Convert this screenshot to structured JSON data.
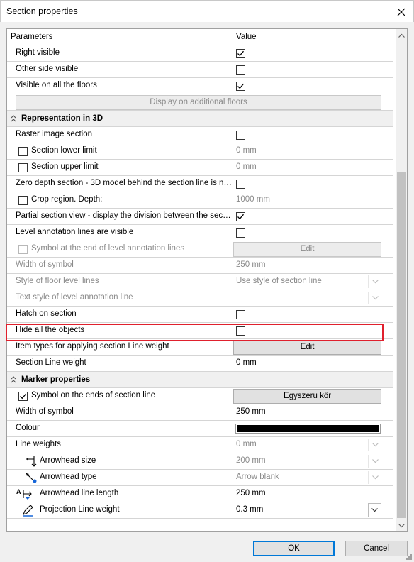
{
  "window": {
    "title": "Section properties"
  },
  "grid": {
    "header": {
      "parameters": "Parameters",
      "value": "Value"
    },
    "rows": {
      "right_visible": {
        "label": "Right visible",
        "checked": true
      },
      "other_side_visible": {
        "label": "Other side visible",
        "checked": false
      },
      "visible_all_floors": {
        "label": "Visible on all the floors",
        "checked": true
      },
      "display_additional": {
        "label": "Display on additional floors"
      },
      "rep3d": {
        "label": "Representation in 3D"
      },
      "raster_section": {
        "label": "Raster image section",
        "checked": false
      },
      "section_lower": {
        "label": "Section lower limit",
        "value": "0 mm",
        "checked": false
      },
      "section_upper": {
        "label": "Section upper limit",
        "value": "0 mm",
        "checked": false
      },
      "zero_depth": {
        "label": "Zero depth section - 3D model behind the section line is n…",
        "checked": false
      },
      "crop_region": {
        "label": "Crop region. Depth:",
        "value": "1000 mm",
        "checked": false
      },
      "partial_section": {
        "label": "Partial section view - display the division between the sec…",
        "checked": true
      },
      "level_annotation": {
        "label": "Level annotation lines are visible",
        "checked": false
      },
      "symbol_end_level": {
        "label": "Symbol at the end of level annotation lines",
        "button": "Edit",
        "checked": false
      },
      "width_symbol_1": {
        "label": "Width of symbol",
        "value": "250 mm"
      },
      "style_floor": {
        "label": "Style of floor level lines",
        "value": "Use style of section line"
      },
      "text_style": {
        "label": "Text style of level annotation line",
        "value": ""
      },
      "hatch_section": {
        "label": "Hatch on section",
        "checked": false
      },
      "hide_objects": {
        "label": "Hide all the objects",
        "checked": false
      },
      "item_types": {
        "label": "Item types for applying section Line weight",
        "button": "Edit"
      },
      "section_line_weight": {
        "label": "Section Line weight",
        "value": "0 mm"
      },
      "marker": {
        "label": "Marker properties"
      },
      "symbol_ends": {
        "label": "Symbol on the ends of section line",
        "button": "Egyszeru kör",
        "checked": true
      },
      "width_symbol_2": {
        "label": "Width of symbol",
        "value": "250 mm"
      },
      "colour": {
        "label": "Colour",
        "swatch": "#000000"
      },
      "line_weights": {
        "label": "Line weights",
        "value": "0 mm"
      },
      "arrowhead_size": {
        "label": "Arrowhead size",
        "value": "200 mm"
      },
      "arrowhead_type": {
        "label": "Arrowhead type",
        "value": "Arrow blank"
      },
      "arrowhead_length": {
        "label": "Arrowhead line length",
        "value": "250 mm"
      },
      "projection_weight": {
        "label": "Projection Line weight",
        "value": "0.3 mm"
      }
    }
  },
  "buttons": {
    "ok": "OK",
    "cancel": "Cancel"
  },
  "colors": {
    "highlight": "#e0202d",
    "ok_border": "#0078d7"
  },
  "icons": [
    "close-icon",
    "collapse-chevron-icon",
    "check-icon",
    "dropdown-arrow-icon",
    "arrowhead-size-icon",
    "arrowhead-type-icon",
    "arrowhead-length-icon",
    "pen-icon",
    "scroll-up-icon",
    "scroll-down-icon"
  ]
}
